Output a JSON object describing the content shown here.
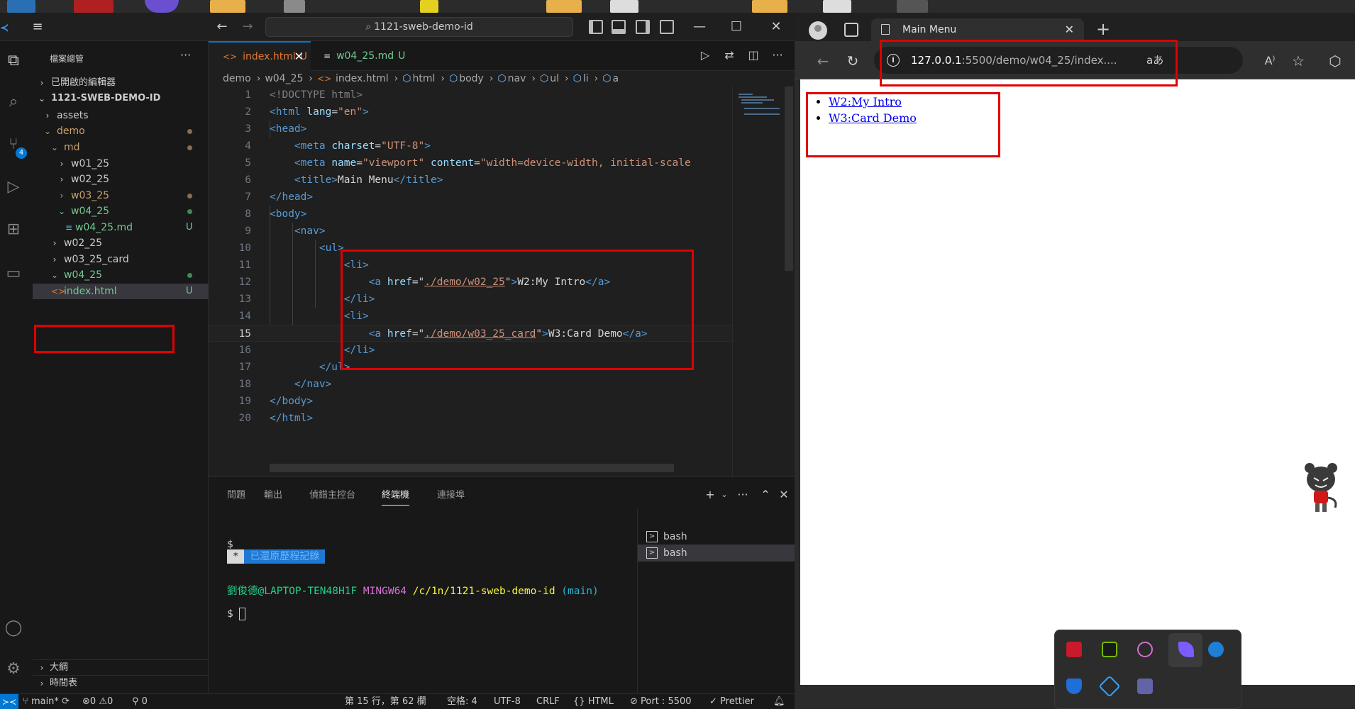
{
  "vscode": {
    "command_center": "1121-sweb-demo-id",
    "explorer": {
      "header": "檔案總管",
      "open_editors": "已開啟的編輯器",
      "workspace": "1121-SWEB-DEMO-ID",
      "items": [
        {
          "label": "assets"
        },
        {
          "label": "demo"
        },
        {
          "label": "md"
        },
        {
          "label": "w01_25"
        },
        {
          "label": "w02_25"
        },
        {
          "label": "w03_25"
        },
        {
          "label": "w04_25"
        },
        {
          "label": "w04_25.md",
          "status": "U"
        },
        {
          "label": "w02_25"
        },
        {
          "label": "w03_25_card"
        },
        {
          "label": "w04_25"
        },
        {
          "label": "index.html",
          "status": "U"
        }
      ],
      "outline": "大綱",
      "timeline": "時間表"
    },
    "source_control_badge": "4",
    "tabs": [
      {
        "label": "index.html",
        "status": "U"
      },
      {
        "label": "w04_25.md",
        "status": "U"
      }
    ],
    "breadcrumb": [
      "demo",
      "w04_25",
      "index.html",
      "html",
      "body",
      "nav",
      "ul",
      "li",
      "a"
    ],
    "code_lines": [
      {
        "n": "1"
      },
      {
        "n": "2"
      },
      {
        "n": "3"
      },
      {
        "n": "4"
      },
      {
        "n": "5"
      },
      {
        "n": "6"
      },
      {
        "n": "7"
      },
      {
        "n": "8"
      },
      {
        "n": "9"
      },
      {
        "n": "10"
      },
      {
        "n": "11"
      },
      {
        "n": "12"
      },
      {
        "n": "13"
      },
      {
        "n": "14"
      },
      {
        "n": "15"
      },
      {
        "n": "16"
      },
      {
        "n": "17"
      },
      {
        "n": "18"
      },
      {
        "n": "19"
      },
      {
        "n": "20"
      }
    ],
    "code": {
      "doctype": "<!DOCTYPE html>",
      "html_open": "<html",
      "lang_attr": "lang",
      "lang_val": "\"en\"",
      "head_open": "<head>",
      "meta": "<meta",
      "charset_attr": "charset",
      "charset_val": "\"UTF-8\"",
      "name_attr": "name",
      "name_val": "\"viewport\"",
      "content_attr": "content",
      "content_val": "\"width=device-width, initial-scale",
      "title_open": "<title>",
      "title_text": "Main Menu",
      "title_close": "</title>",
      "head_close": "</head>",
      "body_open": "<body>",
      "nav_open": "<nav>",
      "ul_open": "<ul>",
      "li_open": "<li>",
      "a_open": "<a",
      "href_attr": "href",
      "href1": "./demo/w02_25",
      "link1_text": "W2:My Intro",
      "a_close": "</a>",
      "li_close": "</li>",
      "href2": "./demo/w03_25_card",
      "link2_text": "W3:Card Demo",
      "ul_close": "</ul>",
      "nav_close": "</nav>",
      "body_close": "</body>",
      "html_close": "</html>"
    },
    "panel": {
      "tabs": [
        "問題",
        "輸出",
        "偵錯主控台",
        "終端機",
        "連接埠"
      ],
      "active_tab": "終端機",
      "terminal": {
        "prompt": "$",
        "restored_star": "*",
        "restored_text": "已還原歷程記錄",
        "user": "劉俊德@LAPTOP-TEN48H1F",
        "mingw": "MINGW64",
        "path": "/c/1n/1121-sweb-demo-id",
        "branch": "(main)"
      },
      "terminal_list": [
        "bash",
        "bash"
      ]
    },
    "status": {
      "branch": "main*",
      "errors": "0",
      "warnings": "0",
      "ports": "0",
      "position": "第 15 行，第 62 欄",
      "spaces": "空格: 4",
      "encoding": "UTF-8",
      "eol": "CRLF",
      "language": "HTML",
      "port": "Port : 5500",
      "prettier": "Prettier"
    }
  },
  "browser": {
    "tab_title": "Main Menu",
    "url_host": "127.0.0.1",
    "url_path": ":5500/demo/w04_25/index....",
    "read_aloud": "aあ",
    "page": {
      "links": [
        "W2:My Intro",
        "W3:Card Demo"
      ]
    }
  },
  "colors": {
    "highlight": "#e00000",
    "accent": "#0078d4",
    "link": "#0000ee"
  }
}
